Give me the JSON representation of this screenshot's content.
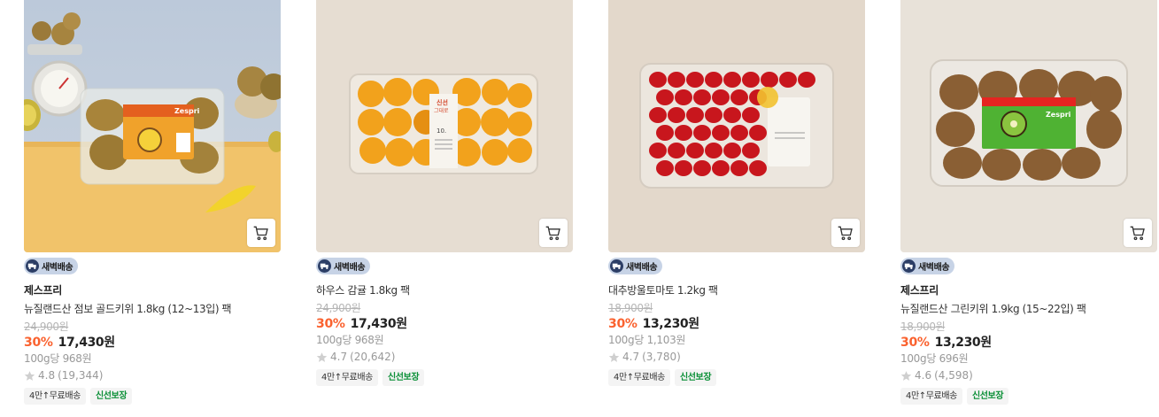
{
  "products": [
    {
      "brand": "제스프리",
      "name": "뉴질랜드산 점보 골드키위 1.8kg (12~13입) 팩",
      "original_price": "24,900원",
      "discount": "30%",
      "price": "17,430원",
      "unit_price": "100g당 968원",
      "rating": "4.8",
      "review_count": "(19,344)",
      "tags": [
        "4만↑무료배송",
        "신선보장"
      ]
    },
    {
      "brand": "",
      "name": "하우스 감귤 1.8kg 팩",
      "original_price": "24,900원",
      "discount": "30%",
      "price": "17,430원",
      "unit_price": "100g당 968원",
      "rating": "4.7",
      "review_count": "(20,642)",
      "tags": [
        "4만↑무료배송",
        "신선보장"
      ]
    },
    {
      "brand": "",
      "name": "대추방울토마토 1.2kg 팩",
      "original_price": "18,900원",
      "discount": "30%",
      "price": "13,230원",
      "unit_price": "100g당 1,103원",
      "rating": "4.7",
      "review_count": "(3,780)",
      "tags": [
        "4만↑무료배송",
        "신선보장"
      ]
    },
    {
      "brand": "제스프리",
      "name": "뉴질랜드산 그린키위 1.9kg (15~22입) 팩",
      "original_price": "18,900원",
      "discount": "30%",
      "price": "13,230원",
      "unit_price": "100g당 696원",
      "rating": "4.6",
      "review_count": "(4,598)",
      "tags": [
        "4만↑무료배송",
        "신선보장"
      ]
    }
  ],
  "delivery_badge": "새벽배송",
  "product_labels": {
    "zespri": "Zespri",
    "tangerine_label_top": "신선",
    "tangerine_label_mid": "그대로",
    "tangerine_label_num": "10."
  },
  "colors": {
    "discount": "#fa622f",
    "badge_bg": "#c7d3e6",
    "tag_green": "#0a8f36",
    "strike_gray": "#b5b5b5"
  },
  "icons": {
    "cart": "cart-icon",
    "truck": "truck-icon",
    "star": "star-icon"
  }
}
